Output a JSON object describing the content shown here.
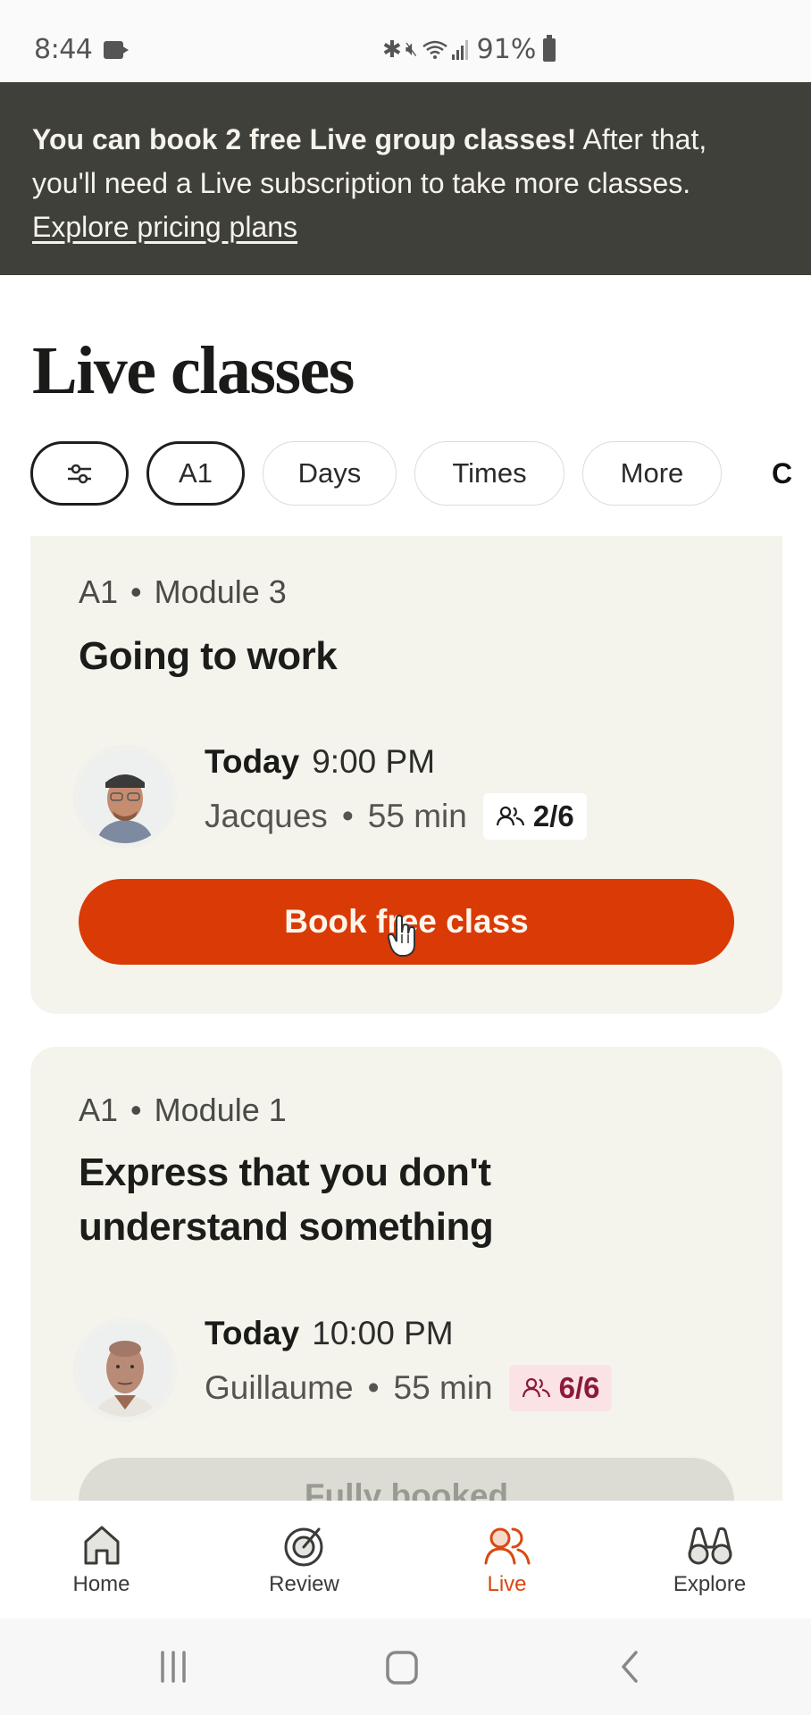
{
  "status_bar": {
    "time": "8:44",
    "battery": "91%",
    "icons": [
      "video-record-icon",
      "bluetooth-icon",
      "mute-icon",
      "wifi-icon",
      "signal-icon",
      "battery-icon"
    ]
  },
  "banner": {
    "bold_text": "You can book 2 free Live group classes!",
    "text": " After that, you'll need a Live subscription to take more classes. ",
    "link": "Explore pricing plans"
  },
  "page": {
    "title": "Live classes"
  },
  "filters": {
    "chips": [
      {
        "label": "",
        "icon": "sliders-icon",
        "active": true
      },
      {
        "label": "A1",
        "active": true
      },
      {
        "label": "Days",
        "active": false
      },
      {
        "label": "Times",
        "active": false
      },
      {
        "label": "More",
        "active": false
      }
    ],
    "clipped_label": "C"
  },
  "classes": [
    {
      "level": "A1",
      "module": "Module 3",
      "title": "Going to work",
      "day": "Today",
      "time": "9:00 PM",
      "teacher": "Jacques",
      "duration": "55 min",
      "capacity": "2/6",
      "full": false,
      "action": "Book free class"
    },
    {
      "level": "A1",
      "module": "Module 1",
      "title": "Express that you don't understand something",
      "title_line1": "Express that you don't",
      "title_line2": "understand something",
      "day": "Today",
      "time": "10:00 PM",
      "teacher": "Guillaume",
      "duration": "55 min",
      "capacity": "6/6",
      "full": true,
      "action": "Fully booked"
    }
  ],
  "separator": "•",
  "bottom_nav": [
    {
      "label": "Home",
      "icon": "home-icon",
      "active": false
    },
    {
      "label": "Review",
      "icon": "target-icon",
      "active": false
    },
    {
      "label": "Live",
      "icon": "people-icon",
      "active": true
    },
    {
      "label": "Explore",
      "icon": "binoculars-icon",
      "active": false
    }
  ],
  "colors": {
    "accent": "#d93a06",
    "banner_bg": "#3f403a",
    "card_bg": "#f4f4ed",
    "full_badge_bg": "#fbe3e5",
    "full_badge_text": "#8b1a3a",
    "nav_active": "#d9480f"
  }
}
